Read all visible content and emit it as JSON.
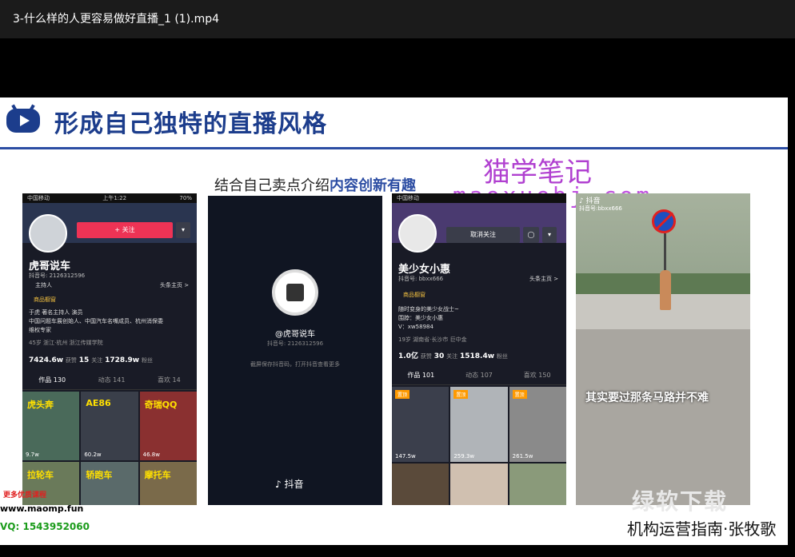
{
  "window": {
    "title": "3-什么样的人更容易做好直播_1 (1).mp4"
  },
  "slide": {
    "title": "形成自己独特的直播风格",
    "subtitle_a": "结合自己卖点介绍",
    "subtitle_b": "内容创新有趣",
    "watermark1": "猫学笔记",
    "watermark2": "maoxuebj.com",
    "website": "www.maomp.fun",
    "promo": "更多优质课程",
    "vq": "VQ: 1543952060",
    "brand_watermark": "绿软下载",
    "author": "机构运营指南·张牧歌"
  },
  "phone1": {
    "carrier": "中国移动",
    "time": "上午1:22",
    "battery": "70%",
    "follow_btn": "+ 关注",
    "name": "虎哥说车",
    "id": "抖音号: 2126312596",
    "role": "主持人",
    "headline": "头条主页 >",
    "shop": "商品橱窗",
    "bio1": "于虎 著名主持人 演员",
    "bio2": "中国问题车展创始人、中国汽车名嘴成员、杭州消保委",
    "bio3": "维权专家",
    "tags": "45岁   浙江·杭州   浙江传媒学院",
    "likes": "7424.6w",
    "likes_label": "获赞",
    "following": "15",
    "following_label": "关注",
    "fans": "1728.9w",
    "fans_label": "粉丝",
    "tabs": [
      "作品 130",
      "动态 141",
      "喜欢 14"
    ],
    "thumbs": [
      {
        "caption": "虎头奔",
        "views": "9.7w"
      },
      {
        "caption": "AE86",
        "views": "60.2w"
      },
      {
        "caption": "奇瑞QQ",
        "views": "46.8w"
      },
      {
        "caption": "拉轮车",
        "views": ""
      },
      {
        "caption": "轿跑车",
        "views": ""
      },
      {
        "caption": "摩托车",
        "views": ""
      }
    ]
  },
  "phone2": {
    "handle": "@虎哥说车",
    "id": "抖音号: 2126312596",
    "hint": "截屏保存抖音码，打开抖音查看更多",
    "logo": "抖音"
  },
  "phone3": {
    "carrier": "中国移动",
    "unfollow": "取消关注",
    "name": "美少女小惠",
    "id": "抖音号: bbxx666",
    "headline": "头条主页 >",
    "shop": "商品橱窗",
    "bio1": "随时变身的美少女战士~",
    "bio2": "围脖：美少女小惠",
    "bio3": "V：xw58984",
    "tags": "19岁   湖南省·长沙市   巨中金",
    "likes": "1.0亿",
    "likes_label": "获赞",
    "following": "30",
    "following_label": "关注",
    "fans": "1518.4w",
    "fans_label": "粉丝",
    "tabs": [
      "作品 101",
      "动态 107",
      "喜欢 150"
    ],
    "pin": "置顶",
    "thumbs": [
      {
        "views": "147.5w"
      },
      {
        "views": "259.3w"
      },
      {
        "views": "261.5w"
      }
    ]
  },
  "phone4": {
    "app": "抖音",
    "id": "抖音号:bbxx666",
    "caption": "其实要过那条马路并不难"
  }
}
